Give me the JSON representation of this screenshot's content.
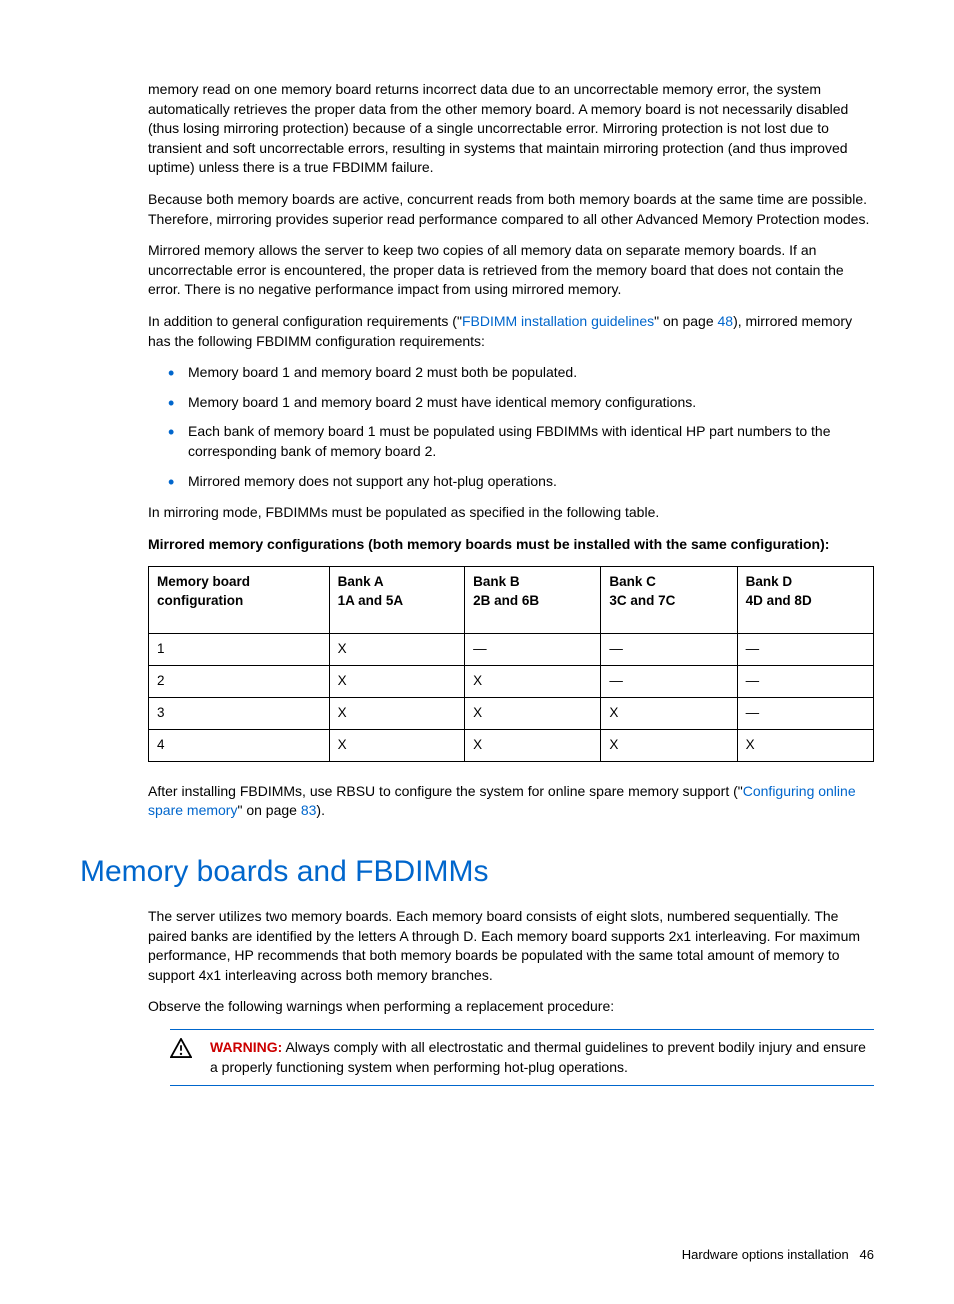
{
  "p1": "memory read on one memory board returns incorrect data due to an uncorrectable memory error, the system automatically retrieves the proper data from the other memory board. A memory board is not necessarily disabled (thus losing mirroring protection) because of a single uncorrectable error. Mirroring protection is not lost due to transient and soft uncorrectable errors, resulting in systems that maintain mirroring protection (and thus improved uptime) unless there is a true FBDIMM failure.",
  "p2": "Because both memory boards are active, concurrent reads from both memory boards at the same time are possible. Therefore, mirroring provides superior read performance compared to all other Advanced Memory Protection modes.",
  "p3": "Mirrored memory allows the server to keep two copies of all memory data on separate memory boards. If an uncorrectable error is encountered, the proper data is retrieved from the memory board that does not contain the error. There is no negative performance impact from using mirrored memory.",
  "p4a": "In addition to general configuration requirements (\"",
  "p4link": "FBDIMM installation guidelines",
  "p4b": "\" on page ",
  "p4page": "48",
  "p4c": "), mirrored memory has the following FBDIMM configuration requirements:",
  "li1": "Memory board 1 and memory board 2 must both be populated.",
  "li2": "Memory board 1 and memory board 2 must have identical memory configurations.",
  "li3": "Each bank of memory board 1 must be populated using FBDIMMs with identical HP part numbers to the corresponding bank of memory board 2.",
  "li4": "Mirrored memory does not support any hot-plug operations.",
  "p5": "In mirroring mode, FBDIMMs must be populated as specified in the following table.",
  "table_caption": "Mirrored memory configurations (both memory boards must be installed with the same configuration):",
  "table": {
    "headers": {
      "c0a": "Memory board",
      "c0b": "configuration",
      "c1a": "Bank A",
      "c1b": "1A and 5A",
      "c2a": "Bank B",
      "c2b": "2B and 6B",
      "c3a": "Bank C",
      "c3b": "3C and 7C",
      "c4a": "Bank D",
      "c4b": "4D and 8D"
    },
    "rows": [
      {
        "c0": "1",
        "c1": "X",
        "c2": "—",
        "c3": "—",
        "c4": "—"
      },
      {
        "c0": "2",
        "c1": "X",
        "c2": "X",
        "c3": "—",
        "c4": "—"
      },
      {
        "c0": "3",
        "c1": "X",
        "c2": "X",
        "c3": "X",
        "c4": "—"
      },
      {
        "c0": "4",
        "c1": "X",
        "c2": "X",
        "c3": "X",
        "c4": "X"
      }
    ]
  },
  "p6a": "After installing FBDIMMs, use RBSU to configure the system for online spare memory support (\"",
  "p6link": "Configuring online spare memory",
  "p6b": "\" on page ",
  "p6page": "83",
  "p6c": ").",
  "h2": "Memory boards and FBDIMMs",
  "p7": "The server utilizes two memory boards. Each memory board consists of eight slots, numbered sequentially. The paired banks are identified by the letters A through D. Each memory board supports 2x1 interleaving. For maximum performance, HP recommends that both memory boards be populated with the same total amount of memory to support 4x1 interleaving across both memory branches.",
  "p8": "Observe the following warnings when performing a replacement procedure:",
  "warning": {
    "label": "WARNING:",
    "text": "  Always comply with all electrostatic and thermal guidelines to prevent bodily injury and ensure a properly functioning system when performing hot-plug operations."
  },
  "footer": {
    "section": "Hardware options installation",
    "page": "46"
  }
}
